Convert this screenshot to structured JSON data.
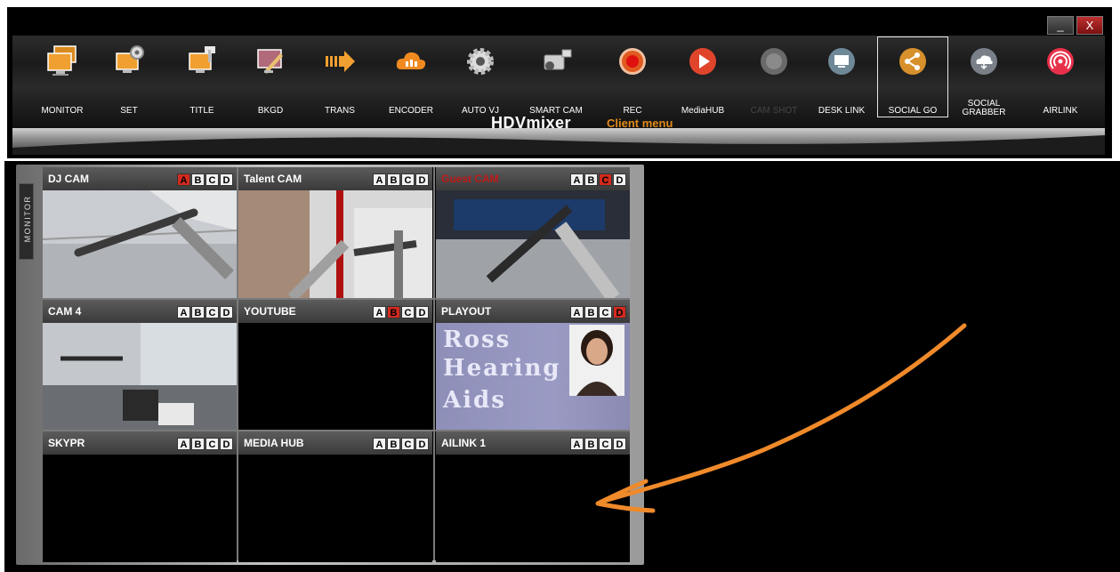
{
  "window": {
    "minimize_label": "_",
    "close_label": "X"
  },
  "toolbar": {
    "items": [
      {
        "label": "MONITOR",
        "icon": "monitor-icon"
      },
      {
        "label": "SET",
        "icon": "set-gear-monitor-icon"
      },
      {
        "label": "TITLE",
        "icon": "title-icon"
      },
      {
        "label": "BKGD",
        "icon": "background-icon"
      },
      {
        "label": "TRANS",
        "icon": "transition-arrow-icon"
      },
      {
        "label": "ENCODER",
        "icon": "cloud-encoder-icon"
      },
      {
        "label": "AUTO VJ",
        "icon": "gear-icon"
      },
      {
        "label": "SMART CAM",
        "icon": "camcorder-icon"
      },
      {
        "label": "REC",
        "icon": "record-icon"
      },
      {
        "label": "MediaHUB",
        "icon": "play-icon"
      },
      {
        "label": "CAM SHOT",
        "icon": "camshot-icon"
      },
      {
        "label": "DESK LINK",
        "icon": "desk-link-icon"
      },
      {
        "label": "SOCIAL GO",
        "icon": "share-icon"
      },
      {
        "label": "SOCIAL GRABBER",
        "icon": "cloud-download-icon"
      },
      {
        "label": "AIRLINK",
        "icon": "airlink-icon"
      }
    ],
    "brand": "HDVmixer",
    "subtitle": "Client menu",
    "accent_color": "#e08a1a"
  },
  "monitor": {
    "tab_label": "MONITOR",
    "cells": [
      {
        "name": "DJ CAM",
        "buttons": [
          "A",
          "B",
          "C",
          "D"
        ],
        "active": "A"
      },
      {
        "name": "Talent CAM",
        "buttons": [
          "A",
          "B",
          "C",
          "D"
        ],
        "active": ""
      },
      {
        "name": "Guest CAM",
        "buttons": [
          "A",
          "B",
          "C",
          "D"
        ],
        "active": "C"
      },
      {
        "name": "CAM 4",
        "buttons": [
          "A",
          "B",
          "C",
          "D"
        ],
        "active": ""
      },
      {
        "name": "YOUTUBE",
        "buttons": [
          "A",
          "B",
          "C",
          "D"
        ],
        "active": "B"
      },
      {
        "name": "PLAYOUT",
        "buttons": [
          "A",
          "B",
          "C",
          "D"
        ],
        "active": "D"
      },
      {
        "name": "SKYPR",
        "buttons": [
          "A",
          "B",
          "C",
          "D"
        ],
        "active": ""
      },
      {
        "name": "MEDIA HUB",
        "buttons": [
          "A",
          "B",
          "C",
          "D"
        ],
        "active": ""
      },
      {
        "name": "AILINK 1",
        "buttons": [
          "A",
          "B",
          "C",
          "D"
        ],
        "active": ""
      }
    ],
    "playout_text": [
      "Ross",
      "Hearing",
      "Aids"
    ]
  }
}
